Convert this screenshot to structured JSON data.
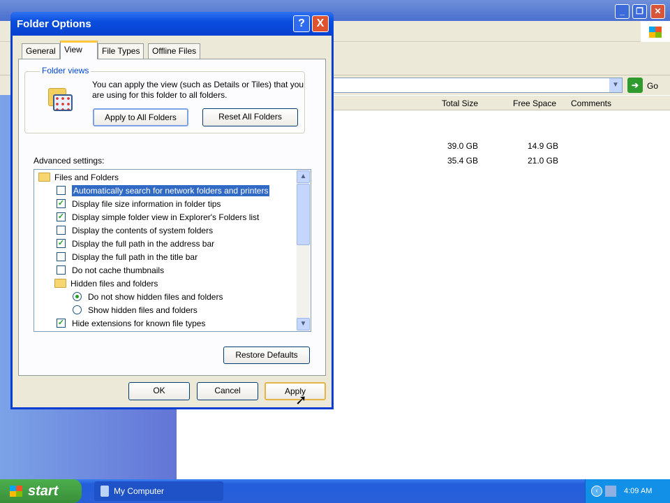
{
  "explorer": {
    "go_label": "Go",
    "columns": [
      "Total Size",
      "Free Space",
      "Comments"
    ],
    "drives": [
      {
        "total": "39.0 GB",
        "free": "14.9 GB"
      },
      {
        "total": "35.4 GB",
        "free": "21.0 GB"
      }
    ]
  },
  "dialog": {
    "title": "Folder Options",
    "help": "?",
    "close": "X",
    "tabs": [
      "General",
      "View",
      "File Types",
      "Offline Files"
    ],
    "folder_views": {
      "label": "Folder views",
      "description": "You can apply the view (such as Details or Tiles) that you are using for this folder to all folders.",
      "apply_all": "Apply to All Folders",
      "reset_all": "Reset All Folders"
    },
    "advanced_label": "Advanced settings:",
    "items": [
      {
        "type": "folder",
        "label": "Files and Folders"
      },
      {
        "type": "checkbox",
        "checked": false,
        "selected": true,
        "label": "Automatically search for network folders and printers"
      },
      {
        "type": "checkbox",
        "checked": true,
        "label": "Display file size information in folder tips"
      },
      {
        "type": "checkbox",
        "checked": true,
        "label": "Display simple folder view in Explorer's Folders list"
      },
      {
        "type": "checkbox",
        "checked": false,
        "label": "Display the contents of system folders"
      },
      {
        "type": "checkbox",
        "checked": true,
        "label": "Display the full path in the address bar"
      },
      {
        "type": "checkbox",
        "checked": false,
        "label": "Display the full path in the title bar"
      },
      {
        "type": "checkbox",
        "checked": false,
        "label": "Do not cache thumbnails"
      },
      {
        "type": "folder",
        "label": "Hidden files and folders"
      },
      {
        "type": "radio",
        "checked": true,
        "label": "Do not show hidden files and folders"
      },
      {
        "type": "radio",
        "checked": false,
        "label": "Show hidden files and folders"
      },
      {
        "type": "checkbox",
        "checked": true,
        "label": "Hide extensions for known file types"
      }
    ],
    "restore_defaults": "Restore Defaults",
    "ok": "OK",
    "cancel": "Cancel",
    "apply": "Apply"
  },
  "taskbar": {
    "start": "start",
    "item": "My Computer",
    "clock": "4:09 AM"
  }
}
